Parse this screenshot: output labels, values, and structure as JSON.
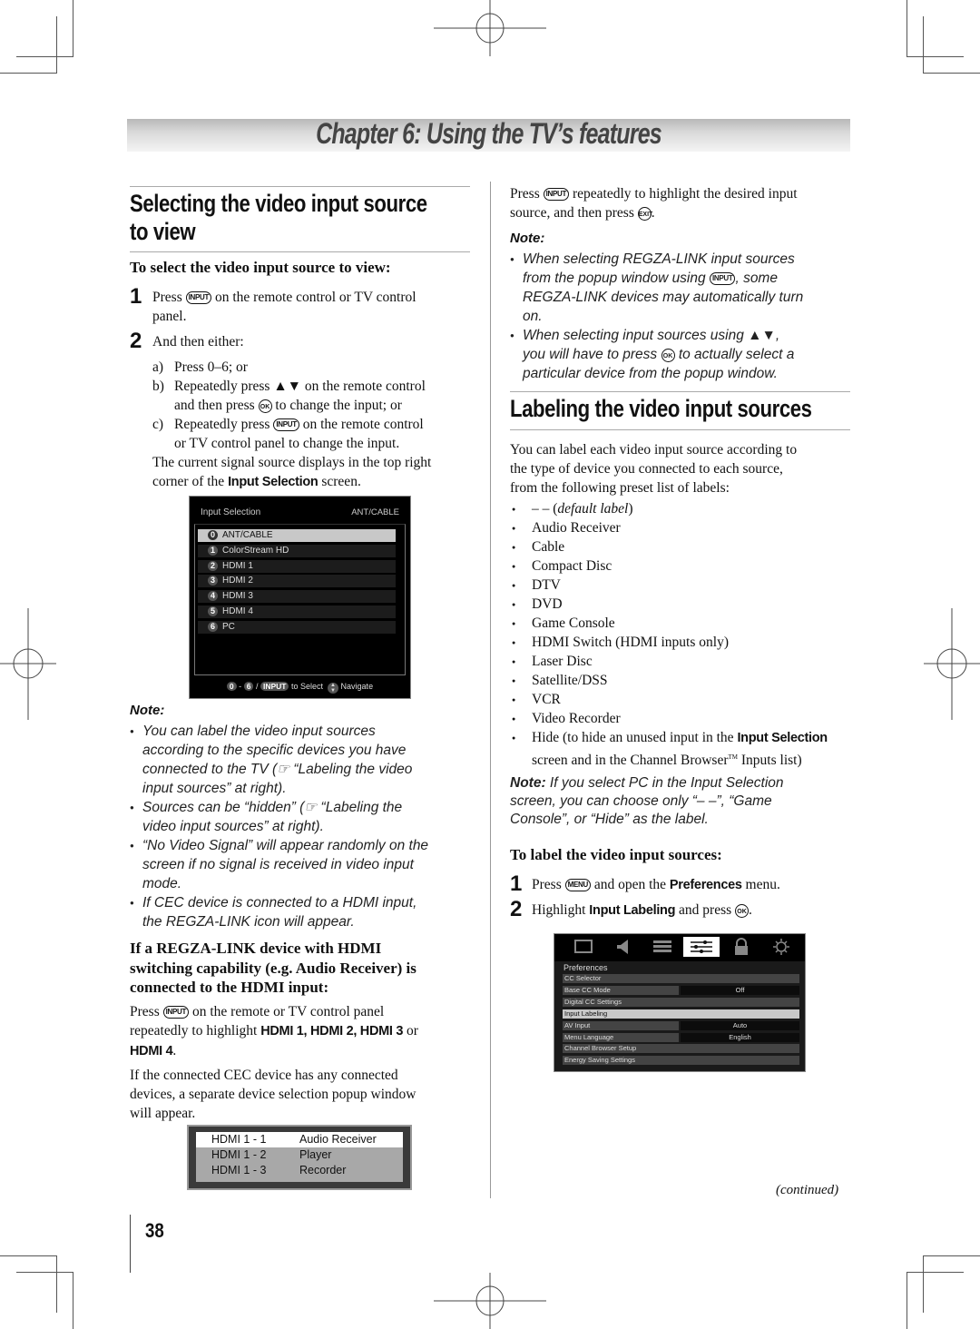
{
  "chapter_title": "Chapter 6: Using the TV’s features",
  "left": {
    "section_title_line1": "Selecting the video input source",
    "section_title_line2": "to view",
    "subhead": "To select the video input source to view:",
    "step1": {
      "num": "1",
      "pre": "Press",
      "key": "INPUT",
      "post": "on the remote control or TV control",
      "post2": "panel."
    },
    "step2": {
      "num": "2",
      "text": "And then either:"
    },
    "opt_a": {
      "letter": "a)",
      "text": "Press 0–6; or"
    },
    "opt_b": {
      "letter": "b)",
      "text1": "Repeatedly press ▲▼ on the remote control",
      "text2_pre": "and then press",
      "key": "OK",
      "text2_post": "to change the input; or"
    },
    "opt_c": {
      "letter": "c)",
      "pre": "Repeatedly press",
      "key": "INPUT",
      "post": "on the remote control",
      "text2": "or TV control panel to change the input."
    },
    "current_signal_1": "The current signal source displays in the top right",
    "current_signal_2_pre": "corner of the",
    "current_signal_2_bold": "Input Selection",
    "current_signal_2_post": "screen.",
    "input_selection_screen": {
      "title": "Input Selection",
      "current": "ANT/CABLE",
      "rows": [
        {
          "num": "0",
          "label": "ANT/CABLE",
          "selected": true
        },
        {
          "num": "1",
          "label": "ColorStream HD"
        },
        {
          "num": "2",
          "label": "HDMI 1"
        },
        {
          "num": "3",
          "label": "HDMI 2"
        },
        {
          "num": "4",
          "label": "HDMI 3"
        },
        {
          "num": "5",
          "label": "HDMI 4"
        },
        {
          "num": "6",
          "label": "PC"
        }
      ],
      "footer": {
        "k0": "0",
        "dash": "-",
        "k6": "6",
        "slash": "/",
        "input": "INPUT",
        "select": "to Select",
        "navigate": "Navigate"
      }
    },
    "note_title": "Note:",
    "notes": [
      {
        "l1": "You can label the video input sources",
        "l2": "according to the specific devices you have",
        "l3": "connected to the TV (☞ “Labeling the video",
        "l4": "input sources” at right)."
      },
      {
        "l1": "Sources can be “hidden” (☞ “Labeling the",
        "l2": "video input sources” at right)."
      },
      {
        "l1": "“No Video Signal” will appear randomly on the",
        "l2": "screen if no signal is received in video input",
        "l3": "mode."
      },
      {
        "l1": "If CEC device is connected to a HDMI input,",
        "l2": "the REGZA-LINK icon will appear."
      }
    ],
    "regza_head_1": "If a REGZA-LINK device with HDMI",
    "regza_head_2": "switching capability (e.g. Audio Receiver) is",
    "regza_head_3": "connected to the HDMI input:",
    "regza_p1_pre": "Press",
    "regza_p1_key": "INPUT",
    "regza_p1_post": "on the remote or TV control panel",
    "regza_p1_l2_pre": "repeatedly to highlight",
    "regza_p1_l2_bold": "HDMI 1, HDMI 2, HDMI 3",
    "regza_p1_l2_post": "or",
    "regza_p1_l3_bold": "HDMI 4",
    "regza_p1_l3_post": ".",
    "regza_p2_l1": "If the connected CEC device has any connected",
    "regza_p2_l2": "devices, a separate device selection popup window",
    "regza_p2_l3": "will appear.",
    "popup_rows": [
      {
        "port": "HDMI 1 -  1",
        "device": "Audio Receiver",
        "selected": true
      },
      {
        "port": "HDMI 1 -  2",
        "device": "Player"
      },
      {
        "port": "HDMI 1 -  3",
        "device": "Recorder"
      }
    ]
  },
  "right": {
    "p1_pre": "Press",
    "p1_key": "INPUT",
    "p1_post": "repeatedly to highlight the desired input",
    "p1_l2_pre": "source, and then press",
    "p1_l2_key": "EXIT",
    "p1_l2_post": ".",
    "note_title": "Note:",
    "notes": [
      {
        "l1": "When selecting REGZA-LINK input sources",
        "l2_pre": "from the popup window using",
        "l2_key": "INPUT",
        "l2_post": ", some",
        "l3": "REGZA-LINK devices may automatically turn",
        "l4": "on."
      },
      {
        "l1": "When selecting input sources using ▲▼,",
        "l2_pre": "you will have to press",
        "l2_key": "OK",
        "l2_post": "to actually select a",
        "l3": "particular device from the popup window."
      }
    ],
    "section_title": "Labeling the video input sources",
    "intro_1": "You can label each video input source according to",
    "intro_2": "the type of device you connected to each source,",
    "intro_3": "from the following preset list of labels:",
    "default_label_dash": "– – (",
    "default_label_it": "default label",
    "default_label_close": ")",
    "labels": [
      "Audio Receiver",
      "Cable",
      "Compact Disc",
      "DTV",
      "DVD",
      "Game Console",
      "HDMI Switch (HDMI inputs only)",
      "Laser Disc",
      "Satellite/DSS",
      "VCR",
      "Video Recorder"
    ],
    "hide_pre": "Hide (to hide an unused input in the",
    "hide_bold": "Input Selection",
    "hide_l2": "screen and in the Channel Browser",
    "hide_tm": "TM",
    "hide_l2_post": " Inputs list)",
    "pc_note_bold": "Note:",
    "pc_note_l1": " If you select PC in the Input Selection",
    "pc_note_l2": "screen, you can choose only “– –”, “Game",
    "pc_note_l3": "Console”, or “Hide” as the label.",
    "subhead": "To label the video input sources:",
    "step1": {
      "num": "1",
      "pre": "Press",
      "key": "MENU",
      "mid": "and open the",
      "bold": "Preferences",
      "post": "menu."
    },
    "step2": {
      "num": "2",
      "pre": "Highlight",
      "bold": "Input Labeling",
      "mid": "and press",
      "key": "OK",
      "post": "."
    },
    "prefs_menu": {
      "icons": [
        "picture-icon",
        "sound-icon",
        "setup-list-icon",
        "preferences-sliders-icon",
        "lock-icon",
        "settings-gear-icon"
      ],
      "active_icon": 3,
      "title": "Preferences",
      "rows": [
        {
          "label": "CC Selector",
          "value": null
        },
        {
          "label": "Base CC Mode",
          "value": "Off"
        },
        {
          "label": "Digital CC Settings",
          "value": null
        },
        {
          "label": "Input Labeling",
          "value": null,
          "selected": true
        },
        {
          "label": "AV Input",
          "value": "Auto"
        },
        {
          "label": "Menu Language",
          "value": "English"
        },
        {
          "label": "Channel Browser Setup",
          "value": null
        },
        {
          "label": "Energy Saving Settings",
          "value": null
        }
      ]
    },
    "continued": "(continued)"
  },
  "page_number": "38"
}
